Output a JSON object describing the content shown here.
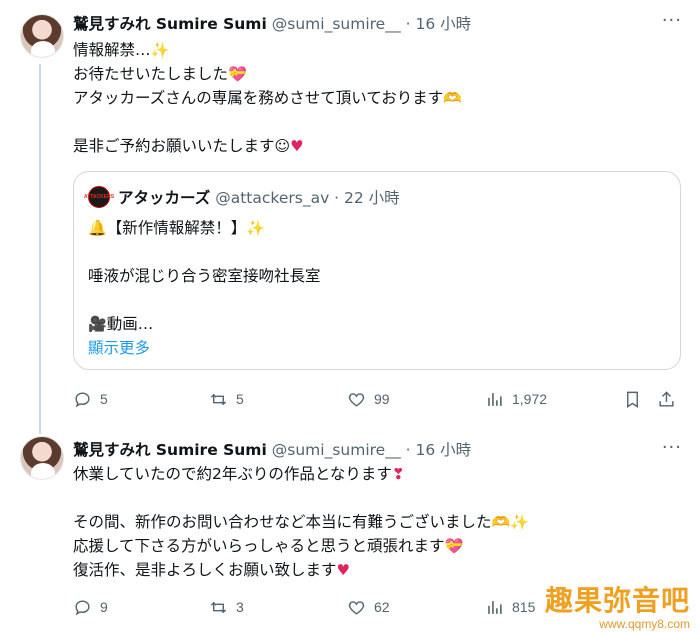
{
  "tweet1": {
    "name": "鷲見すみれ Sumire Sumi",
    "handle": "@sumi_sumire__ · 16 小時",
    "lines": [
      "情報解禁…",
      "お待たせいたしました",
      "アタッカーズさんの専属を務めさせて頂いております",
      "",
      "是非ご予約お願いいたします"
    ],
    "quote": {
      "avatar_text": "ATTACKERS",
      "name": "アタッカーズ",
      "handle": "@attackers_av · 22 小時",
      "line1": "【新作情報解禁！】",
      "line2": "唾液が混じり合う密室接吻社長室",
      "line3": "動画…",
      "show_more": "顯示更多"
    },
    "stats": {
      "replies": "5",
      "retweets": "5",
      "likes": "99",
      "views": "1,972"
    }
  },
  "tweet2": {
    "name": "鷲見すみれ Sumire Sumi",
    "handle": "@sumi_sumire__ · 16 小時",
    "line1": "休業していたので約2年ぶりの作品となります",
    "line3": "その間、新作のお問い合わせなど本当に有難うございました",
    "line4": "応援して下さる方がいらっしゃると思うと頑張れます",
    "line5": "復活作、是非よろしくお願い致します",
    "stats": {
      "replies": "9",
      "retweets": "3",
      "likes": "62",
      "views": "815"
    }
  },
  "watermark": {
    "title": "趣果弥音吧",
    "url": "www.qqmy8.com"
  },
  "colors": {
    "accent": "#1d9bf0",
    "text": "#0f1419",
    "muted": "#536471",
    "border": "#cfd9de",
    "heart": "#e0245e"
  }
}
